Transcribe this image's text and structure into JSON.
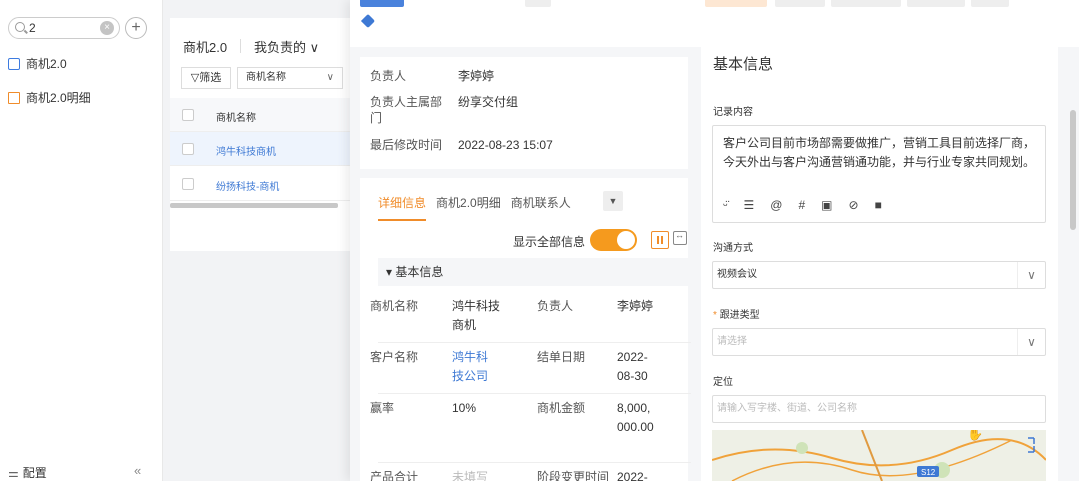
{
  "sidebar": {
    "search_value": "2",
    "clear_label": "×",
    "add_label": "+",
    "items": [
      {
        "label": "商机2.0"
      },
      {
        "label": "商机2.0明细"
      }
    ],
    "footer_label": "配置",
    "collapse_label": "«"
  },
  "list": {
    "title": "商机2.0",
    "view": "我负责的 ∨",
    "filter_label": "筛选",
    "field_select": "商机名称",
    "header": "商机名称",
    "rows": [
      {
        "name": "鸿牛科技商机"
      },
      {
        "name": "纷扬科技-商机"
      }
    ]
  },
  "drawer": {
    "summary": {
      "owner_label": "负责人",
      "owner_value": "李婷婷",
      "dept_label": "负责人主属部门",
      "dept_value": "纷享交付组",
      "modified_label": "最后修改时间",
      "modified_value": "2022-08-23 15:07"
    },
    "tabs": [
      "详细信息",
      "商机2.0明细",
      "商机联系人"
    ],
    "tab_more": "▼",
    "show_all_label": "显示全部信息",
    "section_title": "▾  基本信息",
    "fields": {
      "name_label": "商机名称",
      "name_value": "鸿牛科技商机",
      "owner_label": "负责人",
      "owner_value": "李婷婷",
      "customer_label": "客户名称",
      "customer_value": "鸿牛科技公司",
      "close_label": "结单日期",
      "close_value": "2022-08-30",
      "win_label": "赢率",
      "win_value": "10%",
      "amount_label": "商机金额",
      "amount_value": "8,000,000.00",
      "product_label": "产品合计",
      "product_value": "未填写",
      "stage_label": "阶段变更时间",
      "stage_value": "2022-"
    }
  },
  "form": {
    "title": "基本信息",
    "content_label": "记录内容",
    "content_text": "客户公司目前市场部需要做推广，营销工具目前选择厂商，今天外出与客户沟通营销通功能，并与行业专家共同规划。",
    "toolbar": [
      "ᵕ̈",
      "☰",
      "@",
      "#",
      "▣",
      "⊘",
      "■"
    ],
    "comm_label": "沟通方式",
    "comm_value": "视频会议",
    "followup_label": "跟进类型",
    "followup_required": "*",
    "followup_placeholder": "请选择",
    "location_label": "定位",
    "location_placeholder": "请输入写字楼、街道、公司名称",
    "map_badge": "S12",
    "chevron": "∨"
  }
}
